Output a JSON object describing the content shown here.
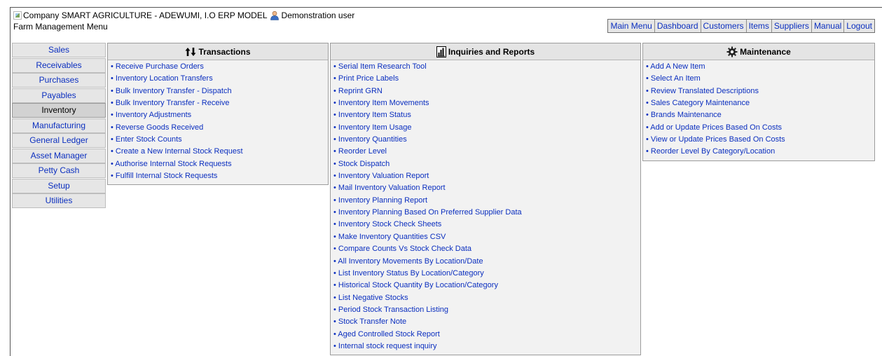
{
  "header": {
    "company_alt": "Company",
    "company_name": "SMART AGRICULTURE - ADEWUMI, I.O ERP MODEL",
    "user": "Demonstration user",
    "subtitle": "Farm Management Menu"
  },
  "quicklinks": [
    "Main Menu",
    "Dashboard",
    "Customers",
    "Items",
    "Suppliers",
    "Manual",
    "Logout"
  ],
  "sidebar": {
    "items": [
      "Sales",
      "Receivables",
      "Purchases",
      "Payables",
      "Inventory",
      "Manufacturing",
      "General Ledger",
      "Asset Manager",
      "Petty Cash",
      "Setup",
      "Utilities"
    ],
    "active": "Inventory"
  },
  "transactions": {
    "title": "Transactions",
    "icon": "up-down-arrows-icon",
    "items": [
      "• Receive Purchase Orders",
      "• Inventory Location Transfers",
      "• Bulk Inventory Transfer - Dispatch",
      "• Bulk Inventory Transfer - Receive",
      "• Inventory Adjustments",
      "• Reverse Goods Received",
      "• Enter Stock Counts",
      "• Create a New Internal Stock Request",
      "• Authorise Internal Stock Requests",
      "• Fulfill Internal Stock Requests"
    ]
  },
  "reports": {
    "title": "Inquiries and Reports",
    "icon": "report-icon",
    "items": [
      "• Serial Item Research Tool",
      "• Print Price Labels",
      "• Reprint GRN",
      "• Inventory Item Movements",
      "• Inventory Item Status",
      "• Inventory Item Usage",
      "• Inventory Quantities",
      "• Reorder Level",
      "• Stock Dispatch",
      "• Inventory Valuation Report",
      "• Mail Inventory Valuation Report",
      "• Inventory Planning Report",
      "• Inventory Planning Based On Preferred Supplier Data",
      "• Inventory Stock Check Sheets",
      "• Make Inventory Quantities CSV",
      "• Compare Counts Vs Stock Check Data",
      "• All Inventory Movements By Location/Date",
      "• List Inventory Status By Location/Category",
      "• Historical Stock Quantity By Location/Category",
      "• List Negative Stocks",
      "• Period Stock Transaction Listing",
      "• Stock Transfer Note",
      "• Aged Controlled Stock Report",
      "• Internal stock request inquiry"
    ]
  },
  "maintenance": {
    "title": "Maintenance",
    "icon": "gear-icon",
    "items": [
      "• Add A New Item",
      "• Select An Item",
      "• Review Translated Descriptions",
      "• Sales Category Maintenance",
      "• Brands Maintenance",
      "• Add or Update Prices Based On Costs",
      "• View or Update Prices Based On Costs",
      "• Reorder Level By Category/Location"
    ]
  },
  "colors": {
    "link": "#0b2fbf",
    "panel_header": "#e4e4e4",
    "panel_body": "#f2f2f2",
    "sidebar_bg": "#e6e6e6",
    "sidebar_active": "#d2d2d2"
  }
}
